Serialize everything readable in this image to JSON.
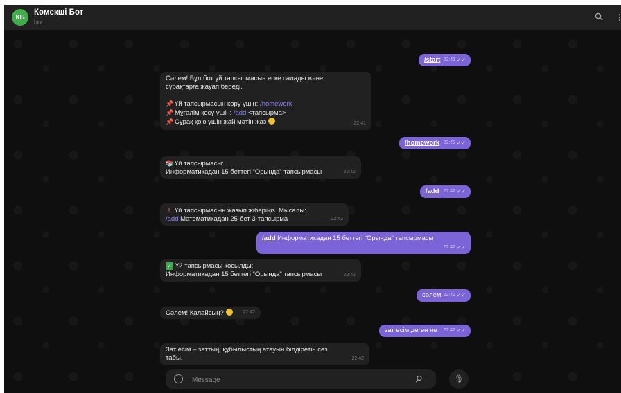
{
  "header": {
    "avatar_initials": "КБ",
    "title": "Көмекші Бот",
    "subtitle": "bot",
    "icons": [
      "search-icon",
      "more-vert-icon"
    ]
  },
  "messages": [
    {
      "dir": "out",
      "lines": [
        {
          "cmd": "/start"
        }
      ],
      "time": "22:41"
    },
    {
      "dir": "in",
      "lines": [
        {
          "text": "Сәлем! Бұл бот үй тапсырмасын еске салады және"
        },
        {
          "text": "сұрақтарға жауап береді."
        },
        {
          "text": ""
        },
        {
          "icon": "pin-icon",
          "text": "Үй тапсырмасын көру үшін: ",
          "cmd": "/homework"
        },
        {
          "icon": "pin-icon",
          "text": "Мұғалім қосу үшін: ",
          "cmd": "/add",
          "after": " <тапсырма>"
        },
        {
          "icon": "pin-icon",
          "text": "Сұрақ қою үшін жай мәтін жаз",
          "emoji": "smile-icon"
        }
      ],
      "time": "22:41"
    },
    {
      "dir": "out",
      "lines": [
        {
          "cmd": "/homework"
        }
      ],
      "time": "22:42"
    },
    {
      "dir": "in",
      "lines": [
        {
          "icon": "books-icon",
          "text": "Үй тапсырмасы:"
        },
        {
          "text": "Информатикадан 15 беттегі “Орында” тапсырмасы"
        }
      ],
      "time": "22:42"
    },
    {
      "dir": "out",
      "lines": [
        {
          "cmd": "/add"
        }
      ],
      "time": "22:42"
    },
    {
      "dir": "in",
      "lines": [
        {
          "icon": "exclamation-icon",
          "text": "Үй тапсырмасын жазып жіберіңіз. Мысалы:"
        },
        {
          "cmd": "/add",
          "after": " Математикадан 25-бет 3-тапсырма"
        }
      ],
      "time": "22:42"
    },
    {
      "dir": "out",
      "lines": [
        {
          "cmd": "/add",
          "after": " Информатикадан 15 беттегі “Орында” тапсырмасы"
        }
      ],
      "time": "22:42"
    },
    {
      "dir": "in",
      "lines": [
        {
          "icon": "check-icon",
          "text": "Үй тапсырмасы қосылды:"
        },
        {
          "text": "Информатикадан 15 беттегі “Орында” тапсырмасы"
        }
      ],
      "time": "22:42"
    },
    {
      "dir": "out",
      "lines": [
        {
          "text": "сәлем"
        }
      ],
      "time": "22:42"
    },
    {
      "dir": "in",
      "lines": [
        {
          "text": "Сәлем! Қалайсың?",
          "emoji": "smile-icon"
        }
      ],
      "time": "22:42"
    },
    {
      "dir": "out",
      "lines": [
        {
          "text": "зат есім деген не"
        }
      ],
      "time": "22:42"
    },
    {
      "dir": "in",
      "lines": [
        {
          "text": "Зат есім – заттың, құбылыстың атауын білдіретін сөз"
        },
        {
          "text": "табы."
        }
      ],
      "time": "22:42"
    }
  ],
  "composer": {
    "placeholder": "Message",
    "value": "",
    "icons": [
      "emoji-icon",
      "attach-icon",
      "mic-icon"
    ]
  },
  "colors": {
    "outgoing_bubble": "#7b63d8",
    "incoming_bubble": "#212121",
    "command_link": "#8f86ff",
    "avatar": "#3fae48"
  }
}
